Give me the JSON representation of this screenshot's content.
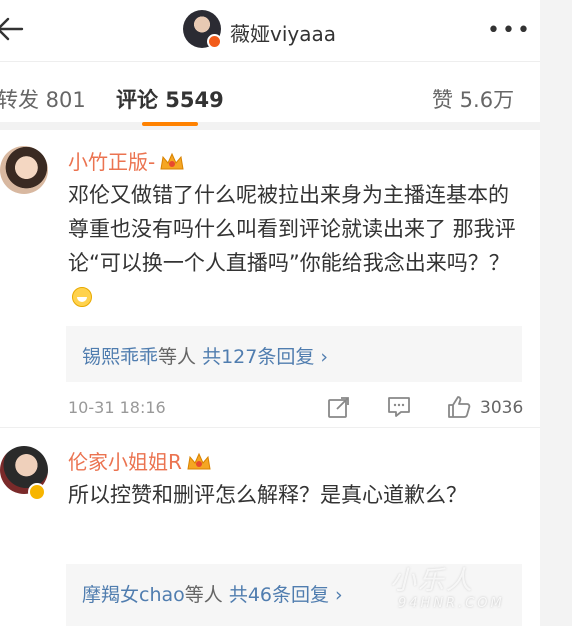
{
  "header": {
    "account_name": "薇娅viyaaa",
    "more_label": "•••",
    "icons": [
      "back-arrow-icon",
      "more-icon"
    ]
  },
  "tabs": [
    {
      "label": "转发 801"
    },
    {
      "label": "评论 5549",
      "active": true
    },
    {
      "label": "赞 5.6万"
    }
  ],
  "comments": [
    {
      "username": "小竹正版-",
      "text": "邓伦又做错了什么呢被拉出来身为主播连基本的尊重也没有吗什么叫看到评论就读出来了 那我评论“可以换一个人直播吗”你能给我念出来吗？？",
      "replies": {
        "users": "锡熙乖乖",
        "etc": "等人",
        "count": "共127条回复 ›"
      },
      "time": "10-31 18:16",
      "likes": "3036"
    },
    {
      "username": "伦家小姐姐R",
      "text": "所以控赞和删评怎么解释？是真心道歉么？",
      "replies": {
        "users": "摩羯女chao",
        "etc": "等人",
        "count": "共46条回复 ›"
      }
    }
  ],
  "watermark": {
    "line1": "小乐人",
    "line2": "94HNR.COM"
  },
  "colors": {
    "accent": "#ff8200",
    "username": "#eb7350",
    "link": "#507daf"
  }
}
